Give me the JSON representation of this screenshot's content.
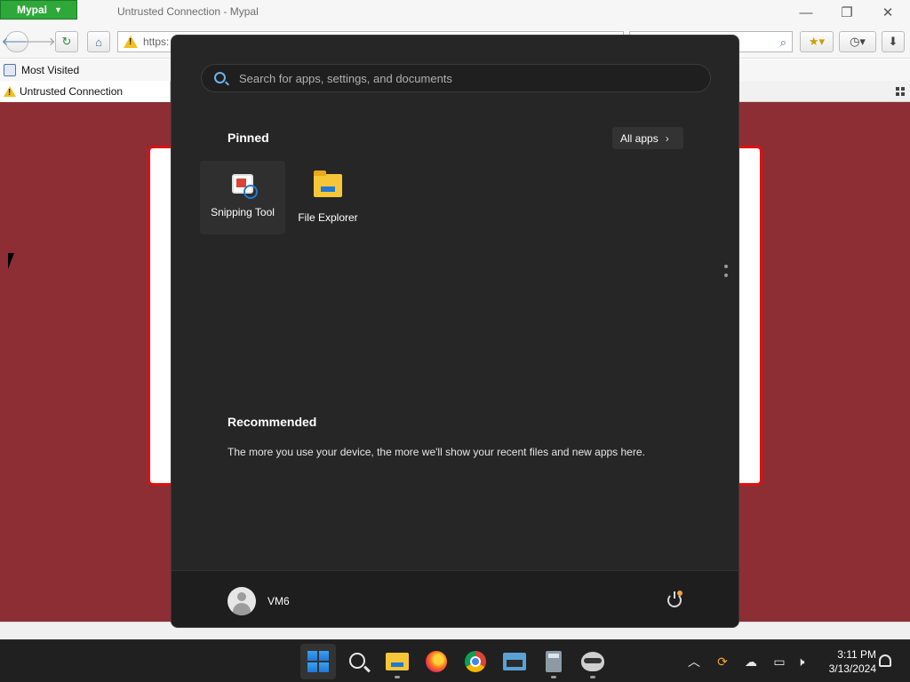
{
  "browser": {
    "app_button": "Mypal",
    "window_title": "Untrusted Connection - Mypal",
    "url_text": "https:",
    "bookmarks_item": "Most Visited",
    "tab_title": "Untrusted Connection"
  },
  "start_menu": {
    "search_placeholder": "Search for apps, settings, and documents",
    "pinned_title": "Pinned",
    "all_apps_label": "All apps",
    "pinned_apps": [
      {
        "label": "Snipping Tool",
        "icon": "snipping-tool-icon"
      },
      {
        "label": "File Explorer",
        "icon": "file-explorer-icon"
      }
    ],
    "recommended_title": "Recommended",
    "recommended_text": "The more you use your device, the more we'll show your recent files and new apps here.",
    "user_name": "VM6"
  },
  "taskbar": {
    "apps": [
      "start-icon",
      "search-icon",
      "file-explorer-icon",
      "firefox-icon",
      "chrome-icon",
      "keyboard-app-icon",
      "calculator-icon",
      "raccoon-app-icon"
    ],
    "time": "3:11 PM",
    "date": "3/13/2024"
  },
  "colors": {
    "content_background": "#8c2e33",
    "error_border": "#e01010",
    "start_background": "#262626",
    "taskbar_background": "#202020",
    "accent_blue": "#1f78d8"
  }
}
